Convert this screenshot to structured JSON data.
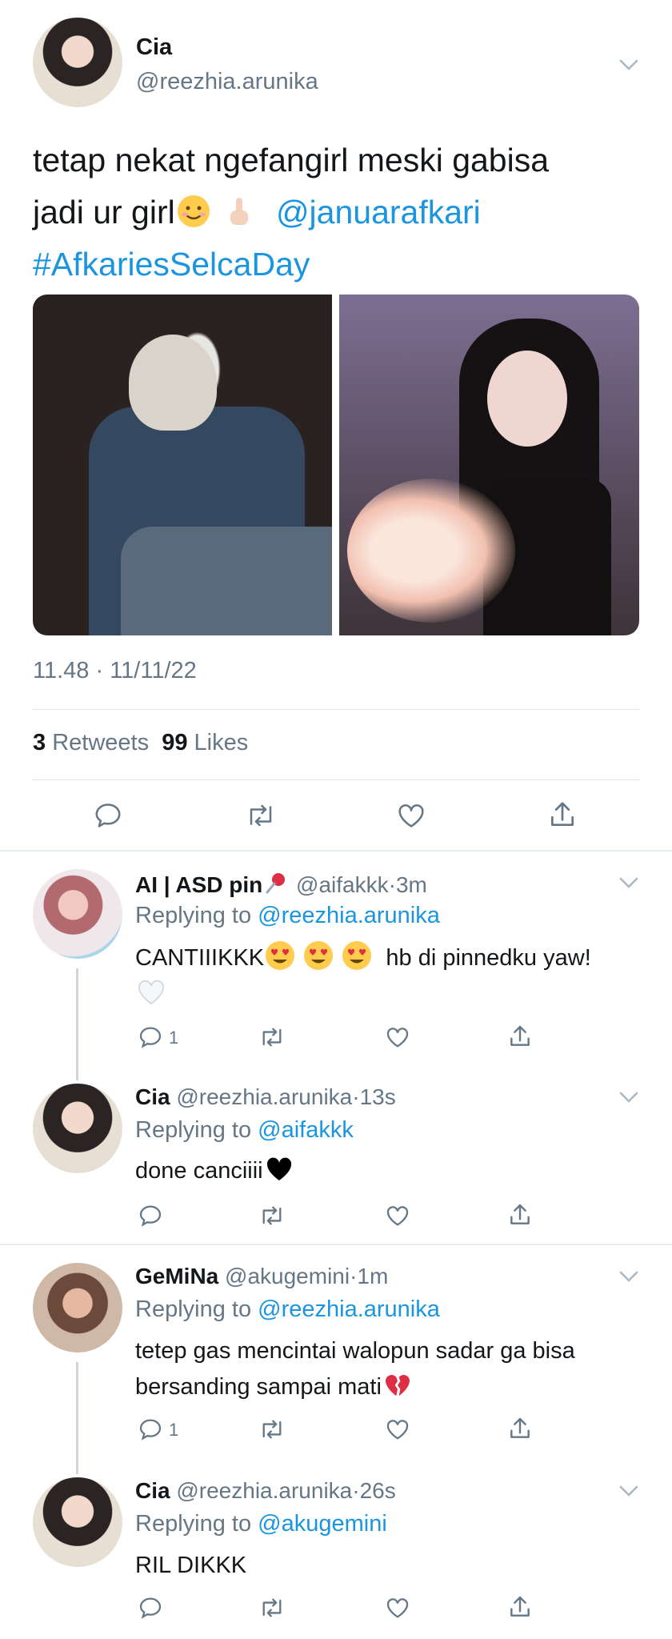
{
  "main_tweet": {
    "name": "Cia",
    "handle": "@reezhia.arunika",
    "text_line1": "tetap nekat ngefangirl meski gabisa",
    "text_line2_plain": "jadi ur girl",
    "mention": "@januarafkari",
    "hashtag": "#AfkariesSelcaDay",
    "emojis": [
      "smiling-face-emoji",
      "pointing-up-emoji"
    ],
    "timestamp": "11.48 · 11/11/22",
    "retweets_count": "3",
    "retweets_label": "Retweets",
    "likes_count": "99",
    "likes_label": "Likes"
  },
  "replies": [
    {
      "name": "AI | ASD pin",
      "name_emoji": "pushpin-emoji",
      "handle": "@aifakkk",
      "time": "3m",
      "replying_label": "Replying to",
      "replying_to": "@reezhia.arunika",
      "text_a": "CANTIIIKKK",
      "text_b": "hb di pinnedku yaw!",
      "text_emojis": [
        "heart-eyes-emoji",
        "heart-eyes-emoji",
        "heart-eyes-emoji",
        "white-heart-emoji"
      ],
      "reply_count": "1"
    },
    {
      "name": "Cia",
      "handle": "@reezhia.arunika",
      "time": "13s",
      "replying_label": "Replying to",
      "replying_to": "@aifakkk",
      "text_a": "done canciiii",
      "text_emojis": [
        "black-heart-emoji"
      ]
    },
    {
      "name": "GeMiNa",
      "handle": "@akugemini",
      "time": "1m",
      "replying_label": "Replying to",
      "replying_to": "@reezhia.arunika",
      "text_a": "tetep gas mencintai walopun sadar ga bisa",
      "text_b": "bersanding sampai mati",
      "text_emojis": [
        "broken-heart-emoji"
      ],
      "reply_count": "1"
    },
    {
      "name": "Cia",
      "handle": "@reezhia.arunika",
      "time": "26s",
      "replying_label": "Replying to",
      "replying_to": "@akugemini",
      "text_a": "RIL DIKKK"
    }
  ],
  "colors": {
    "link": "#1b95e0",
    "secondary_text": "#657786",
    "divider": "#e1e8ed",
    "thread_line": "#ccd6dd"
  },
  "icons": [
    "reply-icon",
    "retweet-icon",
    "like-icon",
    "share-icon",
    "chevron-down-icon"
  ]
}
